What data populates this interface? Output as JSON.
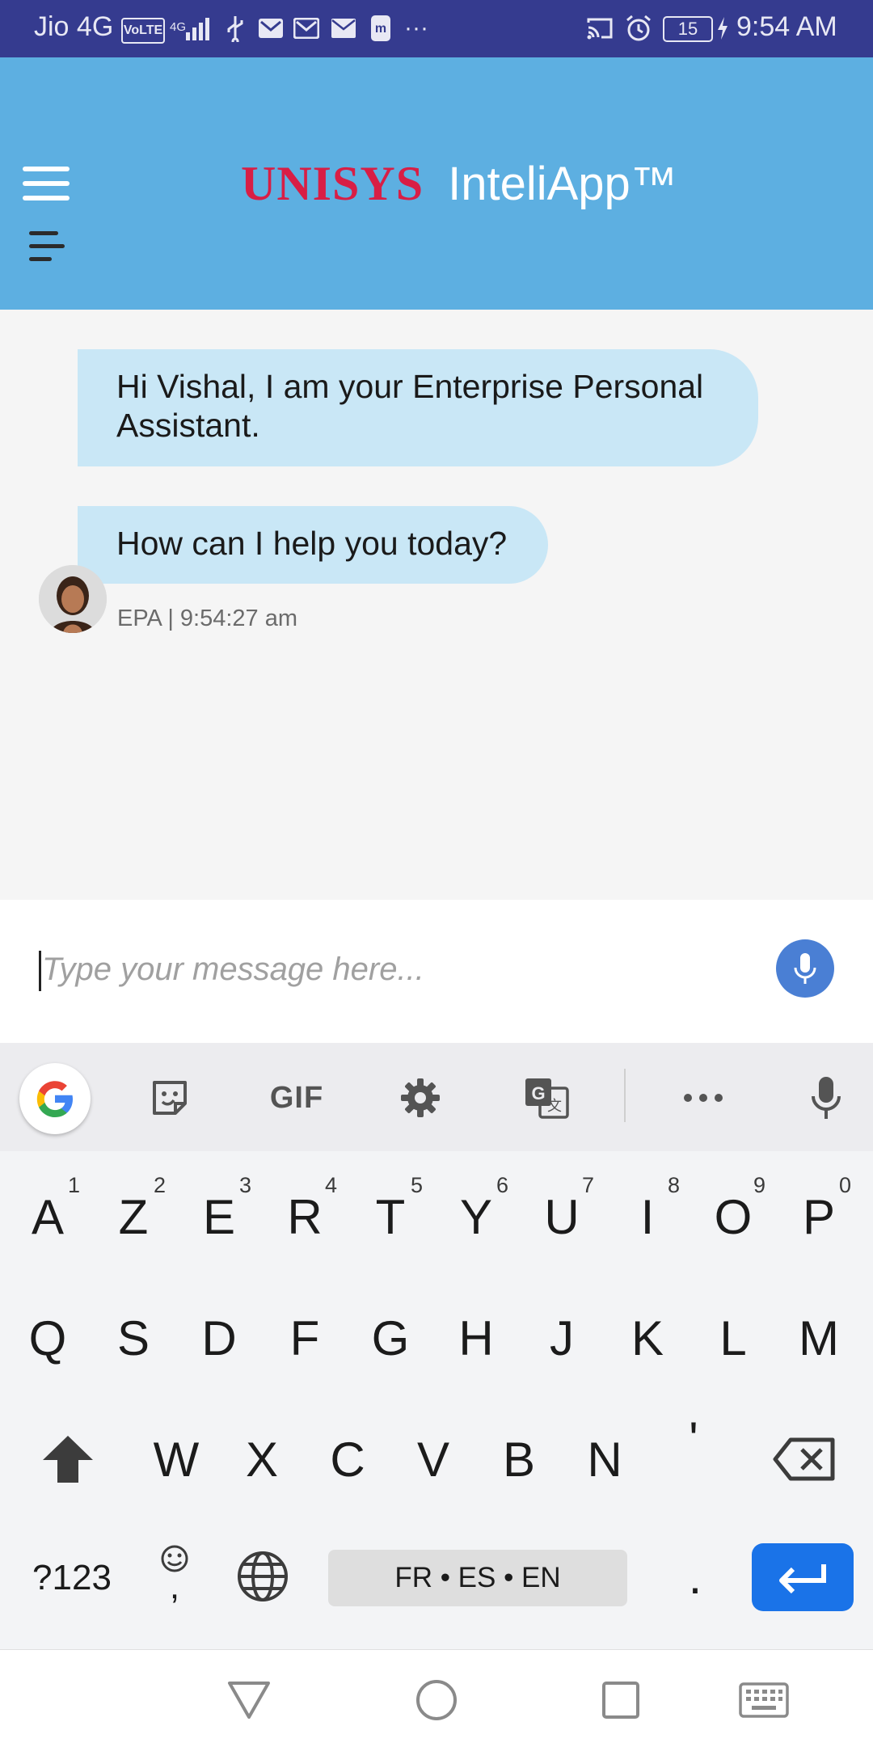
{
  "status_bar": {
    "carrier": "Jio 4G",
    "volte": "VoLTE",
    "network": "4G",
    "battery": "15",
    "time": "9:54 AM",
    "icons": [
      "signal-icon",
      "usb-icon",
      "gmail-icon",
      "gmail-icon",
      "mail-icon",
      "app-icon",
      "more-notifications-icon",
      "cast-icon",
      "alarm-icon",
      "battery-icon",
      "charging-icon"
    ]
  },
  "header": {
    "brand_logo": "UNISYS",
    "app_name": "InteliApp™",
    "background": "#5dafe1",
    "logo_color": "#d81e45"
  },
  "chat": {
    "messages": [
      {
        "sender": "EPA",
        "text": "Hi Vishal, I am your Enterprise Personal Assistant."
      },
      {
        "sender": "EPA",
        "text": "How can I help you today?"
      }
    ],
    "meta": "EPA | 9:54:27 am",
    "bubble_color": "#c9e7f6"
  },
  "input": {
    "placeholder": "Type your message here...",
    "value": ""
  },
  "keyboard": {
    "toolbar": {
      "gif_label": "GIF",
      "items": [
        "google-icon",
        "sticker-icon",
        "gif",
        "settings-icon",
        "translate-icon",
        "more-icon",
        "mic-icon"
      ]
    },
    "row1": [
      {
        "key": "A",
        "hint": "1"
      },
      {
        "key": "Z",
        "hint": "2"
      },
      {
        "key": "E",
        "hint": "3"
      },
      {
        "key": "R",
        "hint": "4"
      },
      {
        "key": "T",
        "hint": "5"
      },
      {
        "key": "Y",
        "hint": "6"
      },
      {
        "key": "U",
        "hint": "7"
      },
      {
        "key": "I",
        "hint": "8"
      },
      {
        "key": "O",
        "hint": "9"
      },
      {
        "key": "P",
        "hint": "0"
      }
    ],
    "row2": [
      "Q",
      "S",
      "D",
      "F",
      "G",
      "H",
      "J",
      "K",
      "L",
      "M"
    ],
    "row3": [
      "W",
      "X",
      "C",
      "V",
      "B",
      "N",
      "'"
    ],
    "symbols_key": "?123",
    "comma_key": ",",
    "period_key": ".",
    "space_label": "FR • ES • EN",
    "accent": "#1a73e8"
  },
  "nav": {
    "items": [
      "back-icon",
      "home-icon",
      "recents-icon",
      "keyboard-icon"
    ]
  }
}
